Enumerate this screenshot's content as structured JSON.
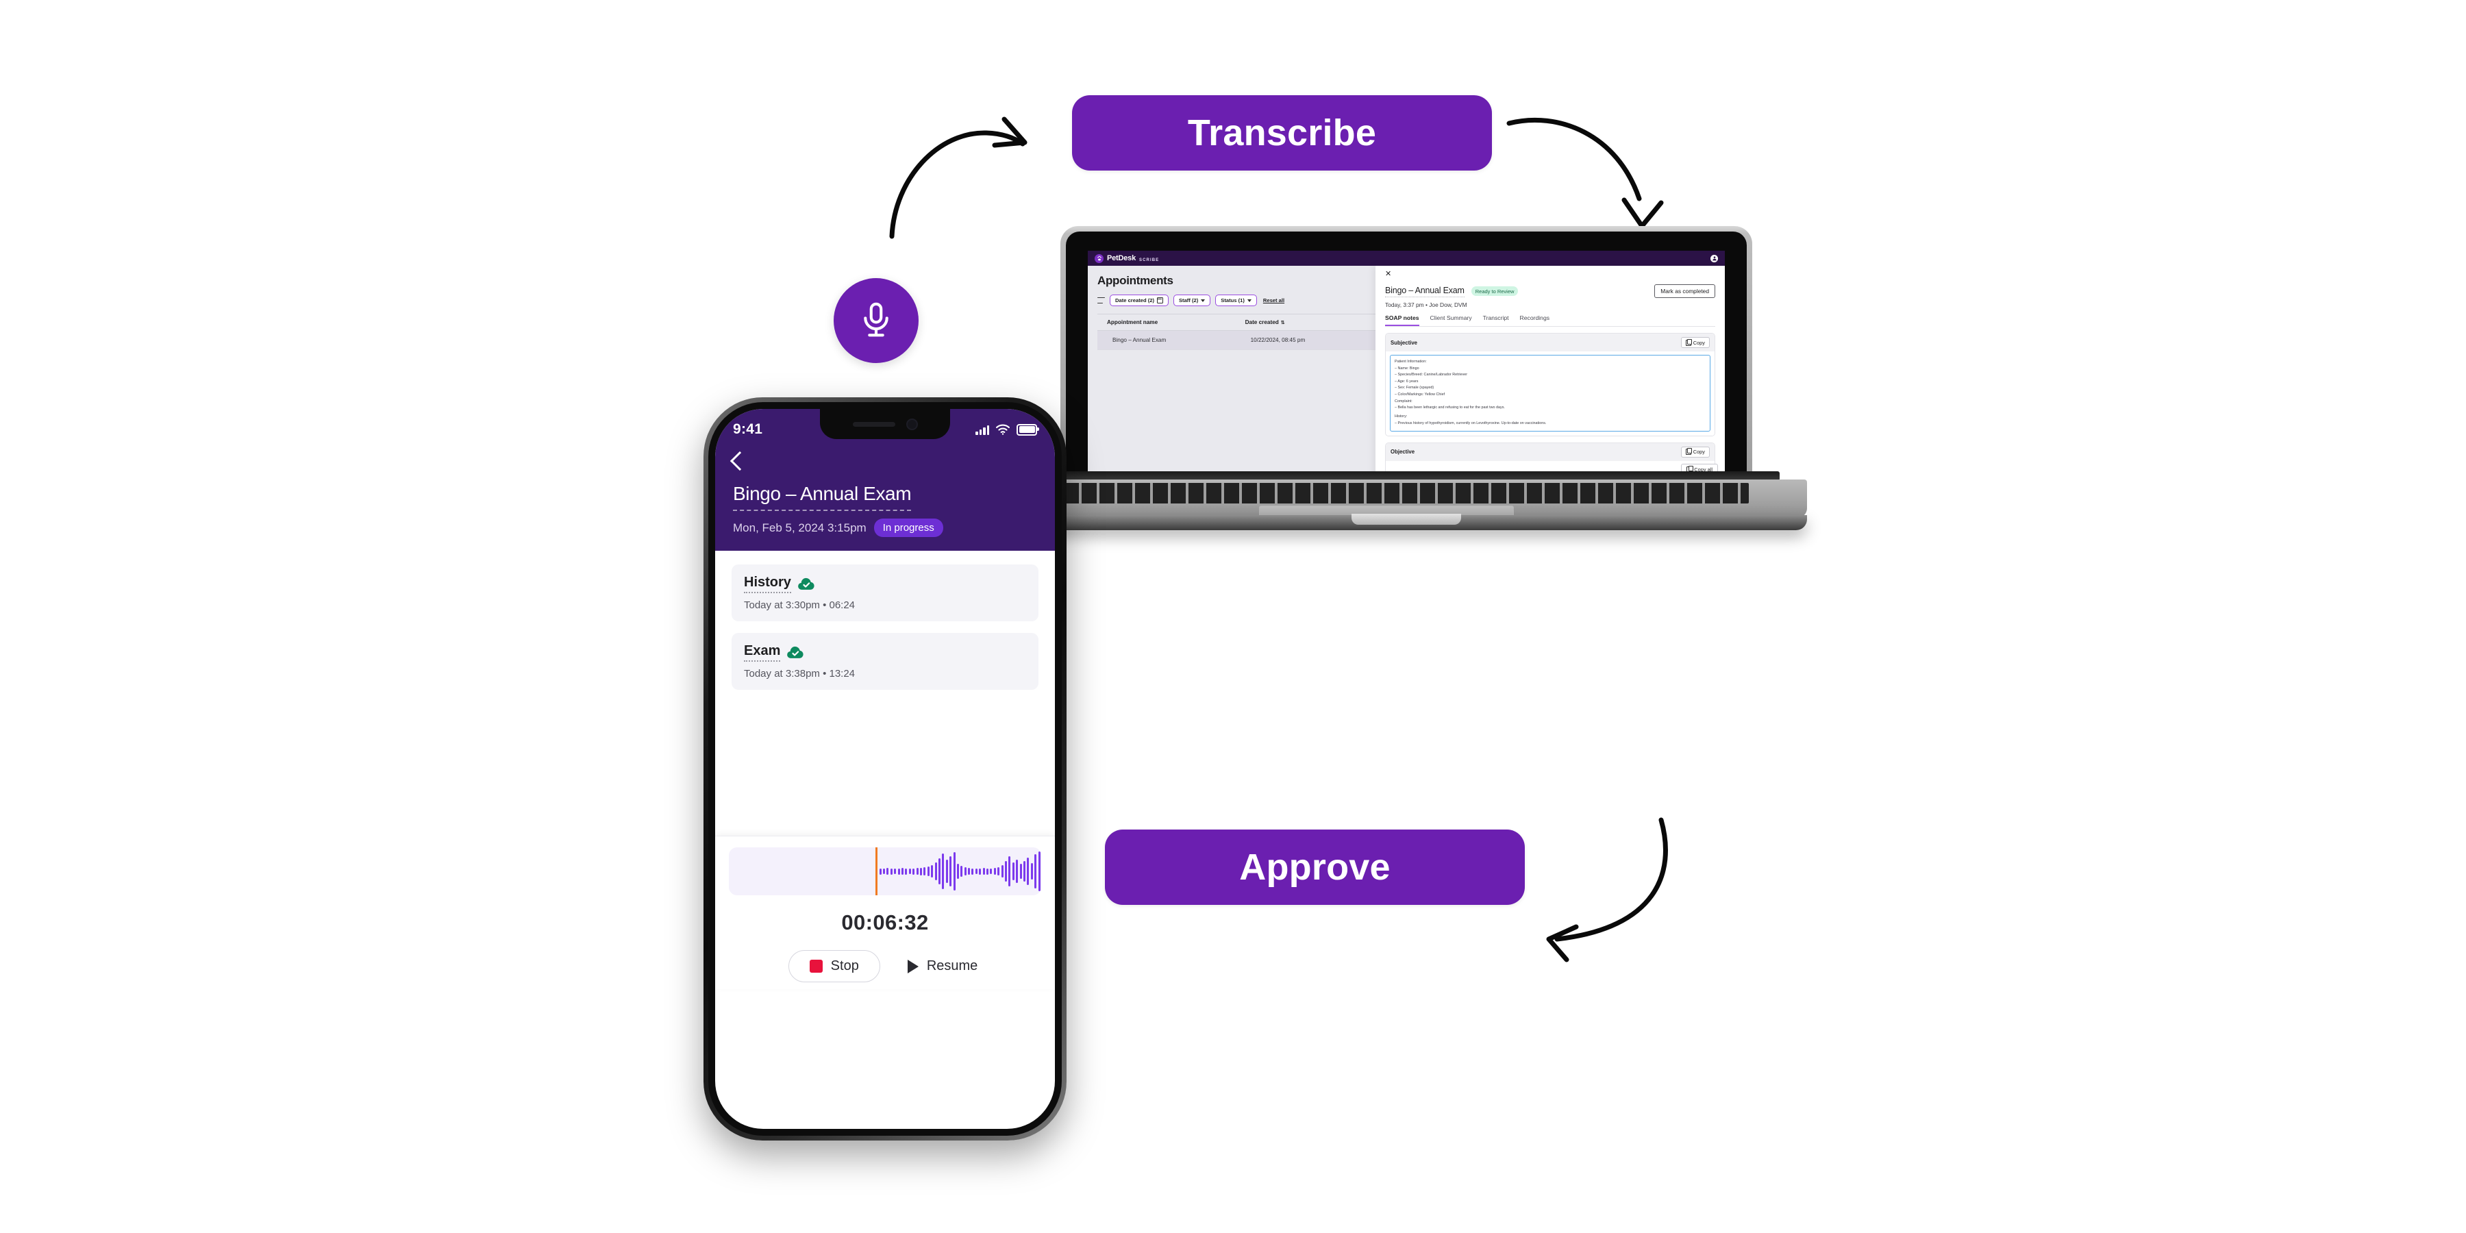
{
  "flow": {
    "transcribe_label": "Transcribe",
    "approve_label": "Approve",
    "mic_icon": "microphone-icon",
    "arrow_to_transcribe": "curved-arrow-right-icon",
    "arrow_to_laptop": "curved-arrow-down-icon",
    "arrow_to_approve": "curved-arrow-left-icon",
    "accent_purple": "#6B1FB0"
  },
  "laptop": {
    "app": {
      "topbar": {
        "brand_name": "PetDesk",
        "brand_sub": "SCRIBE",
        "brand_icon": "petdesk-paw-icon",
        "avatar_icon": "user-avatar-icon"
      },
      "list_pane": {
        "title": "Appointments",
        "filter_icon": "filter-icon",
        "chips": [
          {
            "label": "Date created (2)",
            "icon": "calendar-icon"
          },
          {
            "label": "Staff (2)",
            "icon": "chevron-down-icon"
          },
          {
            "label": "Status (1)",
            "icon": "chevron-down-icon"
          }
        ],
        "reset_label": "Reset all",
        "columns": [
          "Appointment name",
          "Date created"
        ],
        "sort_icon": "sort-arrows-icon",
        "rows": [
          {
            "name": "Bingo – Annual Exam",
            "created": "10/22/2024, 08:45 pm"
          }
        ]
      },
      "detail_pane": {
        "close_icon": "close-icon",
        "title": "Bingo – Annual Exam",
        "status_badge": "Ready to Review",
        "status_badge_color": "#CFF5E3",
        "complete_button": "Mark as completed",
        "meta": "Today, 3:37 pm • Joe Dow, DVM",
        "tabs": [
          {
            "label": "SOAP notes",
            "active": true
          },
          {
            "label": "Client Summary",
            "active": false
          },
          {
            "label": "Transcript",
            "active": false
          },
          {
            "label": "Recordings",
            "active": false
          }
        ],
        "sections": [
          {
            "title": "Subjective",
            "copy_label": "Copy"
          },
          {
            "title": "Objective",
            "copy_label": "Copy"
          }
        ],
        "copy_all_label": "Copy all",
        "subjective_lines": [
          "Patient Information:",
          "– Name: Bingo",
          "– Species/Breed: Canine/Labrador Retriever",
          "– Age: 6 years",
          "– Sex: Female (spayed)",
          "– Color/Markings: Yellow Chief",
          "Complaint:",
          "– Bella has been lethargic and refusing to eat for the past two days.",
          "History:",
          "– Previous history of hypothyroidism, currently on Levothyroxine. Up-to-date on vaccinations."
        ]
      }
    }
  },
  "phone": {
    "status_bar": {
      "time": "9:41",
      "signal_icon": "cellular-bars-icon",
      "wifi_icon": "wifi-icon",
      "battery_icon": "battery-full-icon"
    },
    "back_icon": "back-chevron-icon",
    "title": "Bingo – Annual Exam",
    "subtitle": "Mon, Feb 5, 2024 3:15pm",
    "status_pill": "In progress",
    "recordings": [
      {
        "name": "History",
        "sync_icon": "cloud-check-icon",
        "meta": "Today at 3:30pm • 06:24"
      },
      {
        "name": "Exam",
        "sync_icon": "cloud-check-icon",
        "meta": "Today at 3:38pm • 13:24"
      }
    ],
    "waveform": {
      "playhead_color": "#F07B22",
      "bar_color": "#7C3AED",
      "amplitudes": [
        8,
        9,
        8,
        10,
        9,
        8,
        9,
        10,
        9,
        8,
        9,
        10,
        11,
        12,
        14,
        18,
        26,
        38,
        52,
        34,
        44,
        56,
        22,
        16,
        12,
        10,
        9,
        8,
        9,
        10,
        9,
        8,
        10,
        12,
        18,
        30,
        44,
        26,
        34,
        22,
        30,
        40,
        24,
        50,
        58,
        30,
        20,
        12,
        9,
        8
      ]
    },
    "timer": "00:06:32",
    "stop_label": "Stop",
    "stop_icon": "stop-square-icon",
    "resume_label": "Resume",
    "resume_icon": "play-triangle-icon"
  }
}
